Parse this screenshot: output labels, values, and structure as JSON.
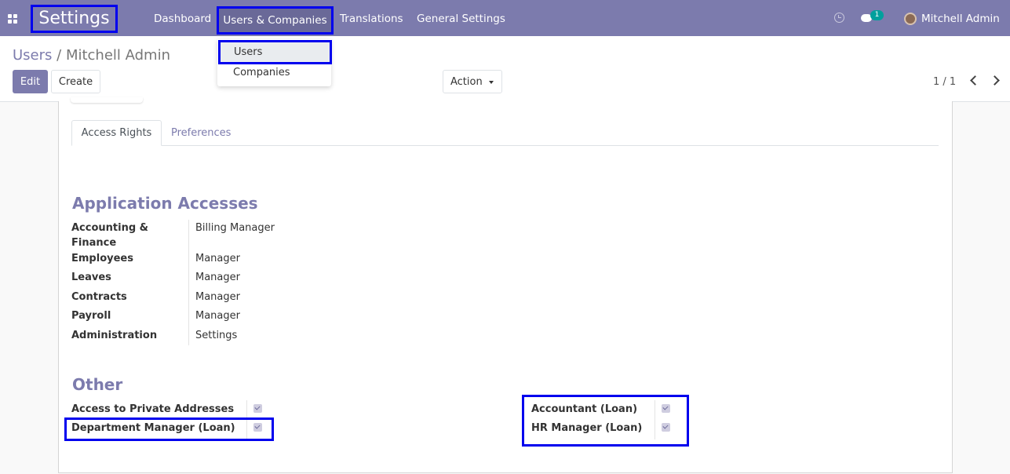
{
  "navbar": {
    "app_title": "Settings",
    "menu": [
      "Dashboard",
      "Users & Companies",
      "Translations",
      "General Settings"
    ],
    "chat_count": "1",
    "user_name": "Mitchell Admin",
    "color": "#7c7bad"
  },
  "dropdown": {
    "items": [
      "Users",
      "Companies"
    ]
  },
  "control_panel": {
    "breadcrumb": [
      "Users",
      "Mitchell Admin"
    ],
    "edit_label": "Edit",
    "create_label": "Create",
    "action_label": "Action",
    "pager": "1 / 1"
  },
  "tabs": [
    "Access Rights",
    "Preferences"
  ],
  "application_accesses": {
    "title": "Application Accesses",
    "rows": [
      {
        "label_line1": "Accounting &",
        "label_line2": "Finance",
        "value": "Billing Manager"
      },
      {
        "label": "Employees",
        "value": "Manager"
      },
      {
        "label": "Leaves",
        "value": "Manager"
      },
      {
        "label": "Contracts",
        "value": "Manager"
      },
      {
        "label": "Payroll",
        "value": "Manager"
      },
      {
        "label": "Administration",
        "value": "Settings"
      }
    ]
  },
  "other": {
    "title": "Other",
    "left": [
      {
        "label": "Access to Private Addresses",
        "checked": true
      },
      {
        "label": "Department Manager (Loan)",
        "checked": true
      }
    ],
    "right": [
      {
        "label": "Accountant (Loan)",
        "checked": true
      },
      {
        "label": "HR Manager (Loan)",
        "checked": true
      }
    ]
  }
}
